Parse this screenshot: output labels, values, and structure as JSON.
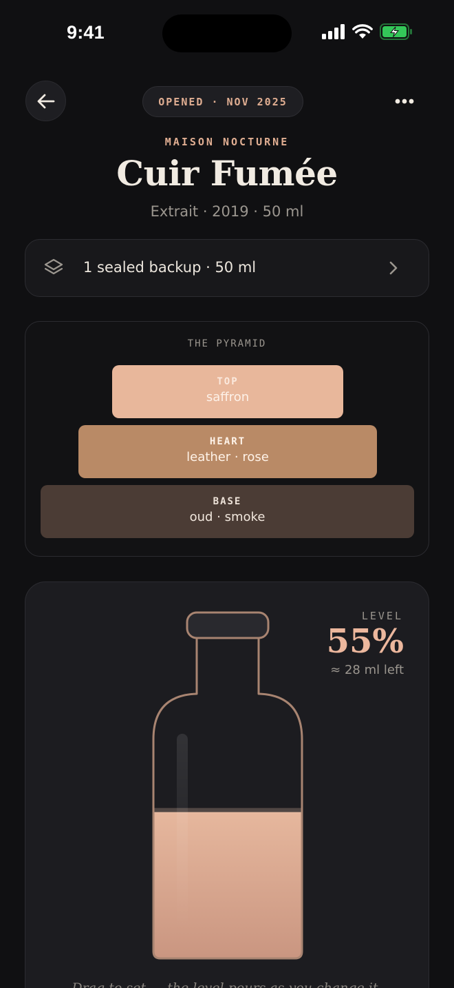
{
  "status_bar": {
    "time": "9:41",
    "icons": [
      "cellular-signal-icon",
      "wifi-icon",
      "battery-charging-icon"
    ],
    "battery_color": "#34c759"
  },
  "header": {
    "back_icon": "arrow-left-icon",
    "opened_label": "OPENED · NOV 2025",
    "more_icon": "more-horizontal-icon"
  },
  "fragrance": {
    "house": "MAISON NOCTURNE",
    "name": "Cuir Fumée",
    "details": "Extrait · 2019 · 50 ml"
  },
  "backup": {
    "icon": "layers-icon",
    "label": "1 sealed backup · 50 ml",
    "chevron_icon": "chevron-right-icon"
  },
  "pyramid": {
    "title": "THE PYRAMID",
    "tiers": [
      {
        "name": "TOP",
        "notes": "saffron",
        "color": "#e8b79b"
      },
      {
        "name": "HEART",
        "notes": "leather · rose",
        "color": "#b98a66"
      },
      {
        "name": "BASE",
        "notes": "oud · smoke",
        "color": "#4b3c35"
      }
    ]
  },
  "level": {
    "label": "LEVEL",
    "percent": 55,
    "percent_text": "55%",
    "remaining_text": "≈ 28 ml left",
    "liquid_color": "#e2b198",
    "hint": "Drag to set — the level pours as you change it."
  },
  "colors": {
    "accent": "#e0ae92",
    "background": "#101012",
    "card": "#1c1c20"
  }
}
